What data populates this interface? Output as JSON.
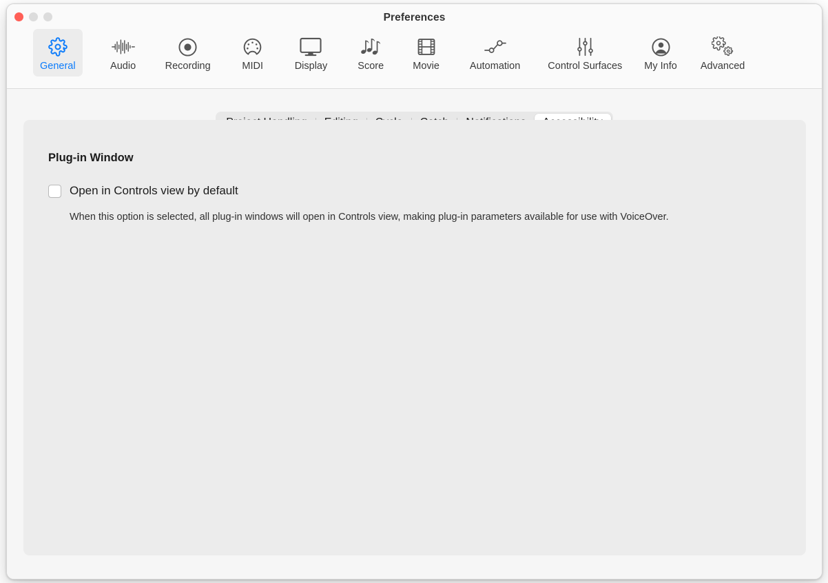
{
  "window": {
    "title": "Preferences",
    "traffic_lights": [
      {
        "name": "close",
        "color": "#ff5f57"
      },
      {
        "name": "minimize",
        "color": "#dcdcdc"
      },
      {
        "name": "maximize",
        "color": "#dcdcdc"
      }
    ]
  },
  "toolbar": {
    "selected": "General",
    "accent_color": "#0b7bfb",
    "items": [
      {
        "label": "General",
        "icon": "gear-icon",
        "selected": true
      },
      {
        "label": "Audio",
        "icon": "waveform-icon",
        "selected": false
      },
      {
        "label": "Recording",
        "icon": "record-circle-icon",
        "selected": false
      },
      {
        "label": "MIDI",
        "icon": "midi-connector-icon",
        "selected": false
      },
      {
        "label": "Display",
        "icon": "monitor-icon",
        "selected": false
      },
      {
        "label": "Score",
        "icon": "music-notes-icon",
        "selected": false
      },
      {
        "label": "Movie",
        "icon": "film-strip-icon",
        "selected": false
      },
      {
        "label": "Automation",
        "icon": "automation-nodes-icon",
        "selected": false
      },
      {
        "label": "Control Surfaces",
        "icon": "sliders-icon",
        "selected": false
      },
      {
        "label": "My Info",
        "icon": "person-circle-icon",
        "selected": false
      },
      {
        "label": "Advanced",
        "icon": "double-gear-icon",
        "selected": false
      }
    ]
  },
  "tabs": {
    "active": "Accessibility",
    "items": [
      {
        "label": "Project Handling",
        "active": false
      },
      {
        "label": "Editing",
        "active": false
      },
      {
        "label": "Cycle",
        "active": false
      },
      {
        "label": "Catch",
        "active": false
      },
      {
        "label": "Notifications",
        "active": false
      },
      {
        "label": "Accessibility",
        "active": true
      }
    ]
  },
  "panel": {
    "section_title": "Plug-in Window",
    "checkbox": {
      "label": "Open in Controls view by default",
      "checked": false
    },
    "description": "When this option is selected, all plug-in windows will open in Controls view, making plug-in parameters available for use with VoiceOver."
  }
}
